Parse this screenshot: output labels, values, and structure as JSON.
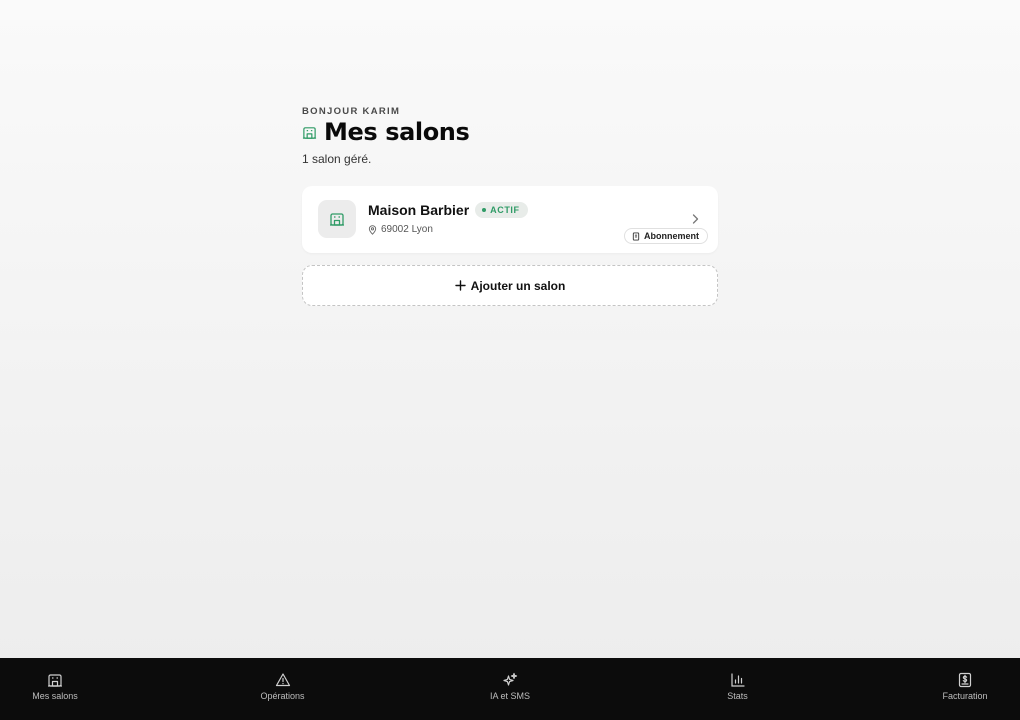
{
  "header": {
    "greeting": "BONJOUR KARIM",
    "title": "Mes salons",
    "title_icon": "building-icon",
    "subtitle": "1 salon géré."
  },
  "salons": [
    {
      "name": "Maison Barbier",
      "status": "ACTIF",
      "location": "69002 Lyon",
      "subscription_label": "Abonnement",
      "icon": "building-icon"
    }
  ],
  "add_salon": {
    "label": "Ajouter un salon",
    "icon": "plus-icon"
  },
  "bottom_nav": {
    "items": [
      {
        "label": "Mes salons",
        "icon": "building-icon"
      },
      {
        "label": "Opérations",
        "icon": "warning-icon"
      },
      {
        "label": "IA et SMS",
        "icon": "sparkles-icon"
      },
      {
        "label": "Stats",
        "icon": "bar-chart-icon"
      },
      {
        "label": "Facturation",
        "icon": "invoice-icon"
      }
    ]
  },
  "colors": {
    "accent_green": "#2f9b66",
    "nav_background": "#0c0c0c",
    "page_background": "#f4f4f4"
  }
}
